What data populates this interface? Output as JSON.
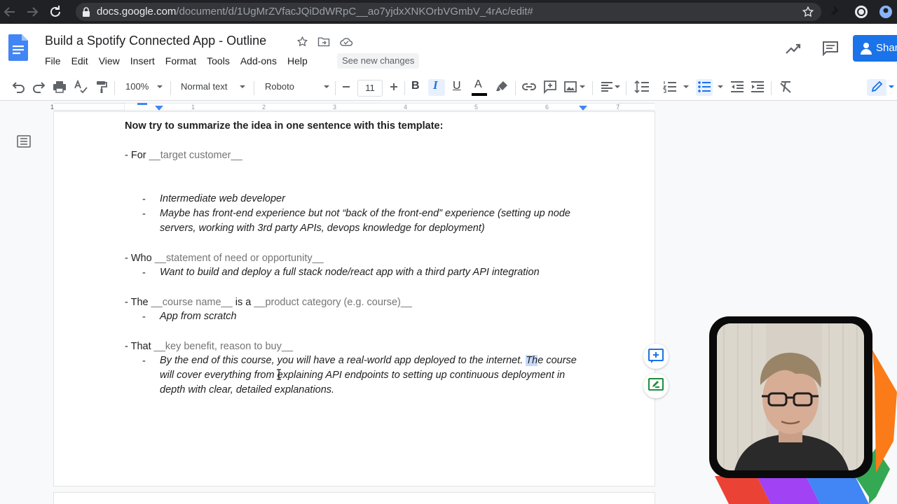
{
  "browser": {
    "url_host": "docs.google.com",
    "url_path": "/document/d/1UgMrZVfacJQiDdWRpC__ao7yjdxXNKOrbVGmbV_4rAc/edit#"
  },
  "doc": {
    "title": "Build a Spotify Connected App - Outline",
    "menu": [
      "File",
      "Edit",
      "View",
      "Insert",
      "Format",
      "Tools",
      "Add-ons",
      "Help"
    ],
    "see_new_changes": "See new changes",
    "share_label": "Share"
  },
  "toolbar": {
    "zoom": "100%",
    "style": "Normal text",
    "font": "Roboto",
    "font_size": "11",
    "bold": "B",
    "italic": "I",
    "underline": "U",
    "text_color_label": "A",
    "colors": {
      "accent": "#1a73e8",
      "active_bg": "#e8f0fe"
    }
  },
  "ruler": {
    "numbers": [
      "1",
      "1",
      "2",
      "3",
      "4",
      "5",
      "6",
      "7"
    ]
  },
  "content": {
    "heading": "Now try to summarize the idea in one sentence with this template:",
    "sections": [
      {
        "prefix": "- For ",
        "hint": "__target customer__",
        "items": [
          {
            "bullet": "-",
            "lines": [
              "Intermediate web developer"
            ]
          },
          {
            "bullet": "-",
            "lines": [
              "Maybe has front-end experience but not “back of the front-end” experience (setting up node",
              "servers, working with 3rd party APIs, devops knowledge for deployment)"
            ]
          }
        ]
      },
      {
        "prefix": "- Who ",
        "hint": "__statement of need or opportunity__",
        "items": [
          {
            "bullet": "-",
            "lines": [
              "Want to build and deploy a full stack node/react app with a third party API integration"
            ]
          }
        ]
      },
      {
        "prefix": "- The ",
        "hint": "__course name__",
        "mid": " is a ",
        "hint2": "__product category (e.g. course)__",
        "items": [
          {
            "bullet": "-",
            "lines": [
              "App from scratch"
            ]
          }
        ]
      },
      {
        "prefix": "- That ",
        "hint": "__key benefit, reason to buy__",
        "items": [
          {
            "bullet": "-",
            "line1_a": "By the end of this course, you will have a real-world app deployed to the internet. ",
            "line1_sel": "Th",
            "line1_b": "e course",
            "lines_rest": [
              "will cover everything from explaining API endpoints to setting up continuous deployment in",
              "depth with clear, detailed explanations."
            ]
          }
        ]
      }
    ]
  },
  "webcam": {
    "stripe_colors": [
      "#ea4335",
      "#a142f4",
      "#4285f4",
      "#34a853",
      "#fa7b17"
    ]
  }
}
